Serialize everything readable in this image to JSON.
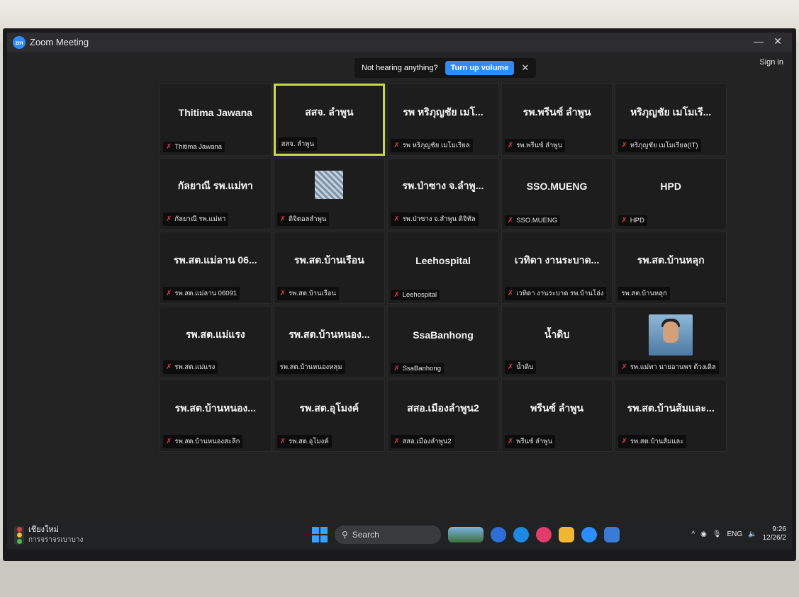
{
  "window": {
    "title": "Zoom Meeting",
    "minimize": "—",
    "close": "✕",
    "sign_in": "Sign in"
  },
  "banner": {
    "message": "Not hearing anything?",
    "button": "Turn up volume",
    "close": "✕"
  },
  "tiles": [
    {
      "display": "Thitima Jawana",
      "label": "Thitima Jawana",
      "muted": true
    },
    {
      "display": "สสจ. ลำพูน",
      "label": "สสจ. ลำพูน",
      "muted": false,
      "active": true
    },
    {
      "display": "รพ หริภุญชัย เมโ...",
      "label": "รพ หริภุญชัย เมโมเรียล",
      "muted": true
    },
    {
      "display": "รพ.พรีนซ์ ลำพูน",
      "label": "รพ.พรีนซ์ ลำพูน",
      "muted": true
    },
    {
      "display": "หริภุญชัย เมโมเรี...",
      "label": "หริภุญชัย เมโมเรียล(IT)",
      "muted": true
    },
    {
      "display": "กัลยาณี รพ.แม่ทา",
      "label": "กัลยาณี รพ.แม่ทา",
      "muted": true
    },
    {
      "display": "",
      "label": "ดิจิตอลลำพูน",
      "muted": true,
      "avatar": "pattern"
    },
    {
      "display": "รพ.ป่าซาง จ.ลำพู...",
      "label": "รพ.ป่าซาง จ.ลำพูน ดิจิทัล",
      "muted": true
    },
    {
      "display": "SSO.MUENG",
      "label": "SSO.MUENG",
      "muted": true
    },
    {
      "display": "HPD",
      "label": "HPD",
      "muted": true
    },
    {
      "display": "รพ.สต.แม่ลาน 06...",
      "label": "รพ.สต.แม่ลาน 06091",
      "muted": true
    },
    {
      "display": "รพ.สต.บ้านเรือน",
      "label": "รพ.สต.บ้านเรือน",
      "muted": true
    },
    {
      "display": "Leehospital",
      "label": "Leehospital",
      "muted": true
    },
    {
      "display": "เวทิดา งานระบาด...",
      "label": "เวทิดา งานระบาด รพ.บ้านโฮ่ง",
      "muted": true
    },
    {
      "display": "รพ.สต.บ้านหลุก",
      "label": "รพ.สต.บ้านหลุก",
      "muted": false
    },
    {
      "display": "รพ.สต.แม่แรง",
      "label": "รพ.สต.แม่แรง",
      "muted": true
    },
    {
      "display": "รพ.สต.บ้านหนอง...",
      "label": "รพ.สต.บ้านหนองหลุม",
      "muted": false
    },
    {
      "display": "SsaBanhong",
      "label": "SsaBanhong",
      "muted": true
    },
    {
      "display": "น้ำดิบ",
      "label": "น้ำดิบ",
      "muted": true
    },
    {
      "display": "",
      "label": "รพ.แม่ทา นายอานพร ด้วงเดิล",
      "muted": true,
      "avatar": "photo"
    },
    {
      "display": "รพ.สต.บ้านหนอง...",
      "label": "รพ.สต.บ้านหนองสะลีก",
      "muted": true
    },
    {
      "display": "รพ.สต.อุโมงค์",
      "label": "รพ.สต.อุโมงค์",
      "muted": true
    },
    {
      "display": "สสอ.เมืองลำพูน2",
      "label": "สสอ.เมืองลำพูน2",
      "muted": true
    },
    {
      "display": "พรีนซ์ ลำพูน",
      "label": "พรีนซ์ ลำพูน",
      "muted": true
    },
    {
      "display": "รพ.สต.บ้านส้มและ...",
      "label": "รพ.สต.บ้านส้มและ",
      "muted": true
    }
  ],
  "taskbar": {
    "weather": {
      "line1": "เชียงใหม่",
      "line2": "การจราจรเบาบาง"
    },
    "search_placeholder": "Search",
    "lang": "ENG",
    "time": "9:26",
    "date": "12/26/2"
  },
  "colors": {
    "accent": "#2d8cff",
    "muted_mic": "#e0393e",
    "active_speaker": "#c9d94a"
  }
}
